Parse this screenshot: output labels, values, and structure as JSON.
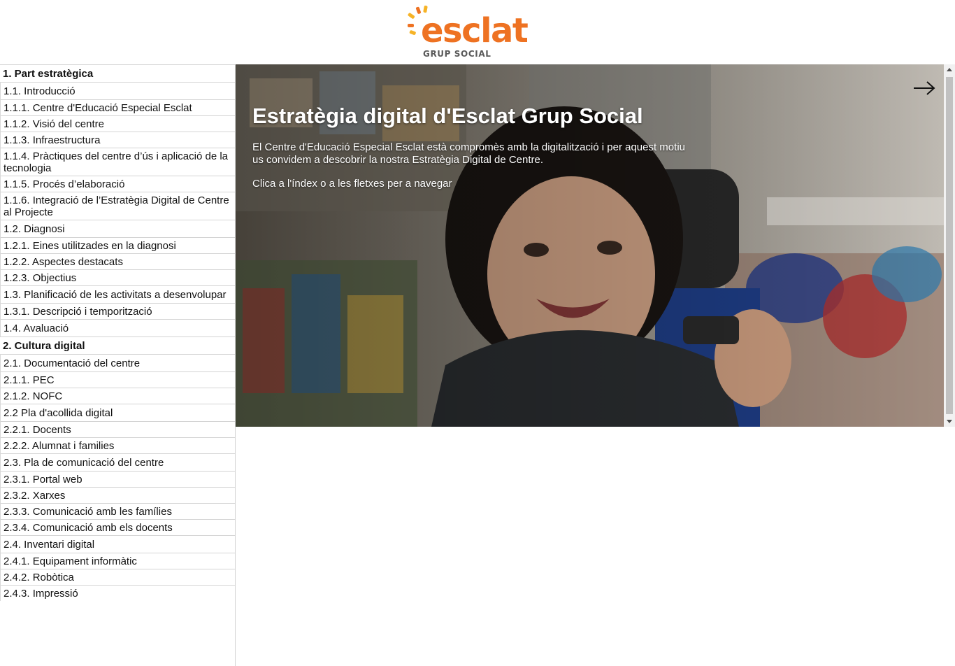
{
  "logo": {
    "word": "esclat",
    "subtitle": "GRUP SOCIAL",
    "brand_orange": "#ee7222",
    "brand_yellow": "#f6b326"
  },
  "sidebar": {
    "sections": [
      {
        "label": "1. Part estratègica",
        "items": [
          {
            "label": "1.1. Introducció",
            "children": [
              "1.1.1. Centre d'Educació Especial Esclat",
              "1.1.2. Visió del centre",
              "1.1.3. Infraestructura",
              "1.1.4. Pràctiques del centre d’ús i aplicació de la tecnologia",
              "1.1.5. Procés d’elaboració",
              "1.1.6. Integració de l’Estratègia Digital de Centre al Projecte"
            ]
          },
          {
            "label": "1.2. Diagnosi",
            "children": [
              "1.2.1. Eines utilitzades en la diagnosi",
              "1.2.2. Aspectes destacats",
              "1.2.3. Objectius"
            ]
          },
          {
            "label": "1.3. Planificació de les activitats a desenvolupar",
            "children": [
              "1.3.1. Descripció i temporització"
            ]
          },
          {
            "label": "1.4. Avaluació",
            "children": []
          }
        ]
      },
      {
        "label": "2. Cultura digital",
        "items": [
          {
            "label": "2.1. Documentació del centre",
            "children": [
              "2.1.1. PEC",
              "2.1.2. NOFC"
            ]
          },
          {
            "label": "2.2 Pla d'acollida digital",
            "children": [
              "2.2.1. Docents",
              "2.2.2. Alumnat i families"
            ]
          },
          {
            "label": "2.3. Pla de comunicació del centre",
            "children": [
              "2.3.1. Portal web",
              "2.3.2. Xarxes",
              "2.3.3. Comunicació amb les famílies",
              "2.3.4. Comunicació amb els docents"
            ]
          },
          {
            "label": "2.4. Inventari digital",
            "children": [
              "2.4.1. Equipament informàtic",
              "2.4.2. Robòtica",
              "2.4.3. Impressió"
            ]
          }
        ]
      }
    ]
  },
  "hero": {
    "title": "Estratègia digital d'Esclat Grup Social",
    "text": "El Centre d'Educació Especial Esclat està compromès amb la digitalització i per aquest motiu us convidem a descobrir la nostra Estratègia Digital de Centre.",
    "hint": "Clica a l'índex o a les fletxes per a navegar",
    "next_icon": "arrow-right-icon"
  }
}
